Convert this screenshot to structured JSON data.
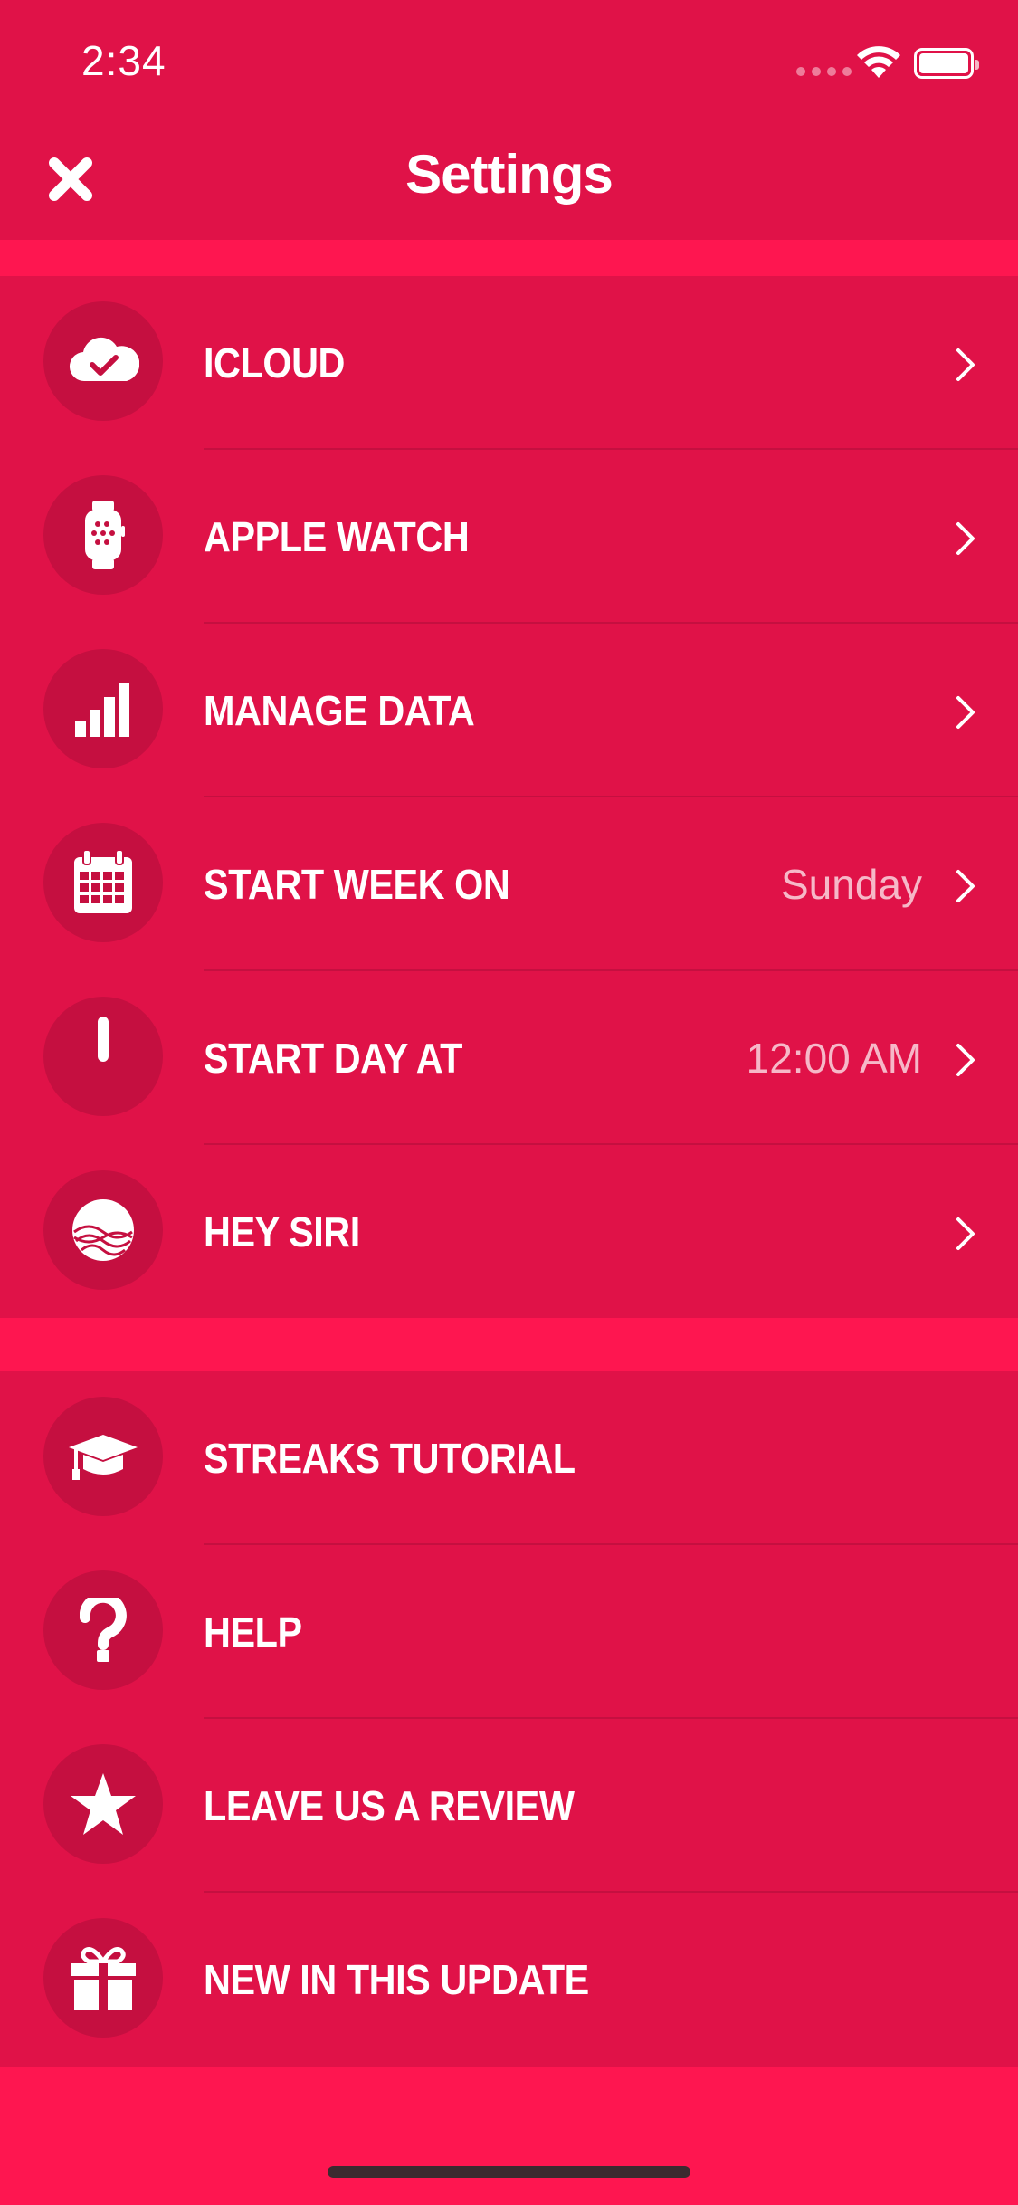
{
  "status_bar": {
    "time": "2:34"
  },
  "nav": {
    "title": "Settings",
    "close_icon": "close-icon"
  },
  "sections": [
    {
      "rows": [
        {
          "icon": "icloud-icon",
          "label": "ICLOUD",
          "value": ""
        },
        {
          "icon": "apple-watch-icon",
          "label": "APPLE WATCH",
          "value": ""
        },
        {
          "icon": "bar-chart-icon",
          "label": "MANAGE DATA",
          "value": ""
        },
        {
          "icon": "calendar-icon",
          "label": "START WEEK ON",
          "value": "Sunday"
        },
        {
          "icon": "clock-icon",
          "label": "START DAY AT",
          "value": "12:00 AM"
        },
        {
          "icon": "siri-icon",
          "label": "HEY SIRI",
          "value": ""
        }
      ]
    },
    {
      "rows": [
        {
          "icon": "graduation-cap-icon",
          "label": "STREAKS TUTORIAL"
        },
        {
          "icon": "question-mark-icon",
          "label": "HELP"
        },
        {
          "icon": "star-icon",
          "label": "LEAVE US A REVIEW"
        },
        {
          "icon": "gift-icon",
          "label": "NEW IN THIS UPDATE"
        }
      ]
    }
  ],
  "colors": {
    "background": "#fe1650",
    "panel": "#e01248",
    "icon_circle": "#c50f40",
    "text": "#ffffff"
  }
}
